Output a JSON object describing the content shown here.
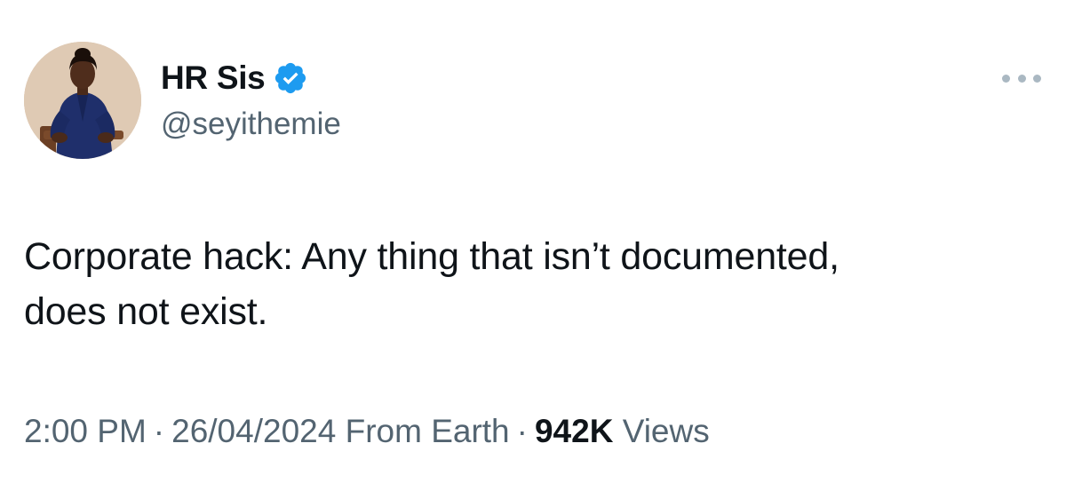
{
  "author": {
    "display_name": "HR Sis",
    "handle": "@seyithemie",
    "verified": true,
    "avatar_icon": "profile-photo"
  },
  "menu": {
    "icon": "more-horizontal-icon"
  },
  "tweet": {
    "text_line1": "Corporate hack: Any thing that isn’t documented,",
    "text_line2": "does not exist."
  },
  "meta": {
    "time": "2:00 PM",
    "separator": "·",
    "date": "26/04/2024",
    "source": "From Earth",
    "views_count": "942K",
    "views_label": "Views"
  },
  "colors": {
    "text": "#0f1419",
    "secondary": "#536471",
    "verified": "#1d9bf0"
  }
}
